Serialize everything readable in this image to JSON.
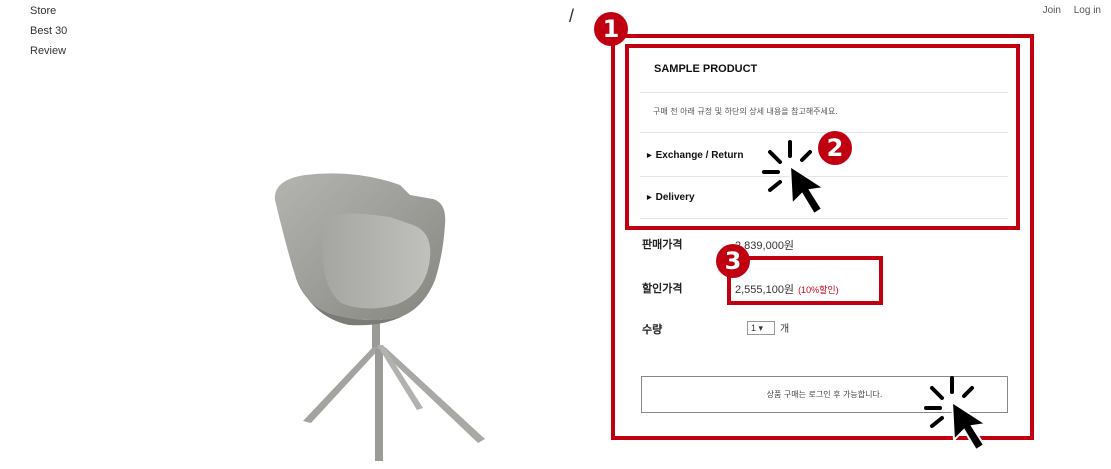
{
  "nav": {
    "items": [
      "Store",
      "Best 30",
      "Review"
    ]
  },
  "header": {
    "separator": "/",
    "join": "Join",
    "login": "Log in"
  },
  "product": {
    "title": "SAMPLE PRODUCT",
    "description": "구매 전 아래 규정 및 하단의 상세 내용을 참고해주세요.",
    "accordion": [
      "Exchange / Return",
      "Delivery"
    ],
    "price_label": "판매가격",
    "price_value": "2,839,000원",
    "sale_label": "할인가격",
    "sale_value": "2,555,100원",
    "sale_discount": "(10%할인)",
    "qty_label": "수량",
    "qty_value": "1 ▾",
    "qty_unit": "개",
    "buy_button": "상품 구매는 로그인 후 가능합니다."
  },
  "annotations": {
    "badges": [
      "1",
      "2",
      "3"
    ],
    "color": "#c00010"
  },
  "icons": [
    "chair-image",
    "click-cursor-icon"
  ]
}
